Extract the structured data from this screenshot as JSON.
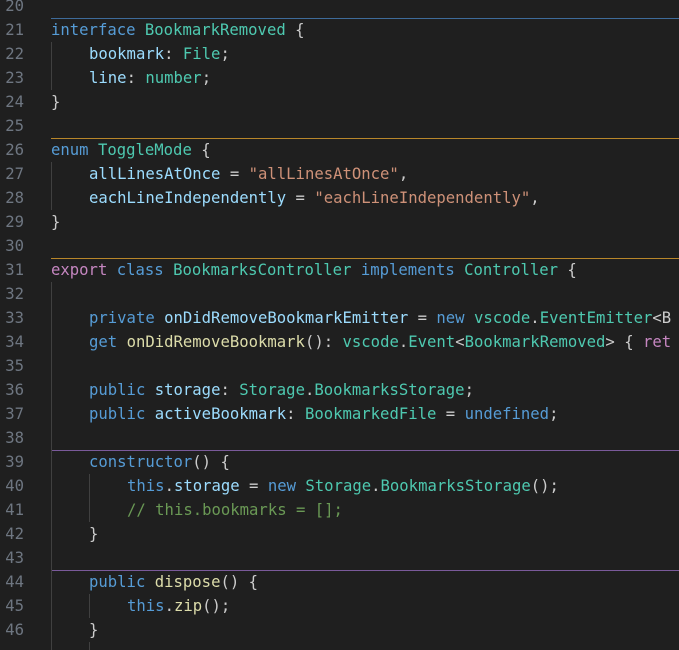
{
  "editor": {
    "line_numbers": [
      "20",
      "21",
      "22",
      "23",
      "24",
      "25",
      "26",
      "27",
      "28",
      "29",
      "30",
      "31",
      "32",
      "33",
      "34",
      "35",
      "36",
      "37",
      "38",
      "39",
      "40",
      "41",
      "42",
      "43",
      "44",
      "45",
      "46"
    ],
    "code": {
      "l21": {
        "t1": "interface",
        "t2": " ",
        "t3": "BookmarkRemoved",
        "t4": " {"
      },
      "l22": {
        "t1": "bookmark",
        "t2": ": ",
        "t3": "File",
        "t4": ";"
      },
      "l23": {
        "t1": "line",
        "t2": ": ",
        "t3": "number",
        "t4": ";"
      },
      "l24": {
        "t1": "}"
      },
      "l26": {
        "t1": "enum",
        "t2": " ",
        "t3": "ToggleMode",
        "t4": " {"
      },
      "l27": {
        "t1": "allLinesAtOnce",
        "t2": " = ",
        "t3": "\"allLinesAtOnce\"",
        "t4": ","
      },
      "l28": {
        "t1": "eachLineIndependently",
        "t2": " = ",
        "t3": "\"eachLineIndependently\"",
        "t4": ","
      },
      "l29": {
        "t1": "}"
      },
      "l31": {
        "t1": "export",
        "t2": " ",
        "t3": "class",
        "t4": " ",
        "t5": "BookmarksController",
        "t6": " ",
        "t7": "implements",
        "t8": " ",
        "t9": "Controller",
        "t10": " {"
      },
      "l33": {
        "t1": "private",
        "t2": " ",
        "t3": "onDidRemoveBookmarkEmitter",
        "t4": " = ",
        "t5": "new",
        "t6": " ",
        "t7": "vscode",
        "t8": ".",
        "t9": "EventEmitter",
        "t10": "<B"
      },
      "l34": {
        "t1": "get",
        "t2": " ",
        "t3": "onDidRemoveBookmark",
        "t4": "(): ",
        "t5": "vscode",
        "t6": ".",
        "t7": "Event",
        "t8": "<",
        "t9": "BookmarkRemoved",
        "t10": "> { ",
        "t11": "ret"
      },
      "l36": {
        "t1": "public",
        "t2": " ",
        "t3": "storage",
        "t4": ": ",
        "t5": "Storage",
        "t6": ".",
        "t7": "BookmarksStorage",
        "t8": ";"
      },
      "l37": {
        "t1": "public",
        "t2": " ",
        "t3": "activeBookmark",
        "t4": ": ",
        "t5": "BookmarkedFile",
        "t6": " = ",
        "t7": "undefined",
        "t8": ";"
      },
      "l39": {
        "t1": "constructor",
        "t2": "() {"
      },
      "l40": {
        "t1": "this",
        "t2": ".",
        "t3": "storage",
        "t4": " = ",
        "t5": "new",
        "t6": " ",
        "t7": "Storage",
        "t8": ".",
        "t9": "BookmarksStorage",
        "t10": "();"
      },
      "l41": {
        "t1": "// this.bookmarks = [];"
      },
      "l42": {
        "t1": "}"
      },
      "l44": {
        "t1": "public",
        "t2": " ",
        "t3": "dispose",
        "t4": "() {"
      },
      "l45": {
        "t1": "this",
        "t2": ".",
        "t3": "zip",
        "t4": "();"
      },
      "l46": {
        "t1": "}"
      }
    },
    "colors": {
      "background": "#1f1f1f",
      "keyword": "#569cd6",
      "control_keyword": "#c586c0",
      "type": "#4ec9b0",
      "property": "#9cdcfe",
      "function": "#dcdcaa",
      "string": "#ce9178",
      "comment": "#6a9955",
      "separator_blue": "#3e6b9a",
      "separator_orange": "#b8862a",
      "separator_purple": "#7a5a9a"
    }
  }
}
